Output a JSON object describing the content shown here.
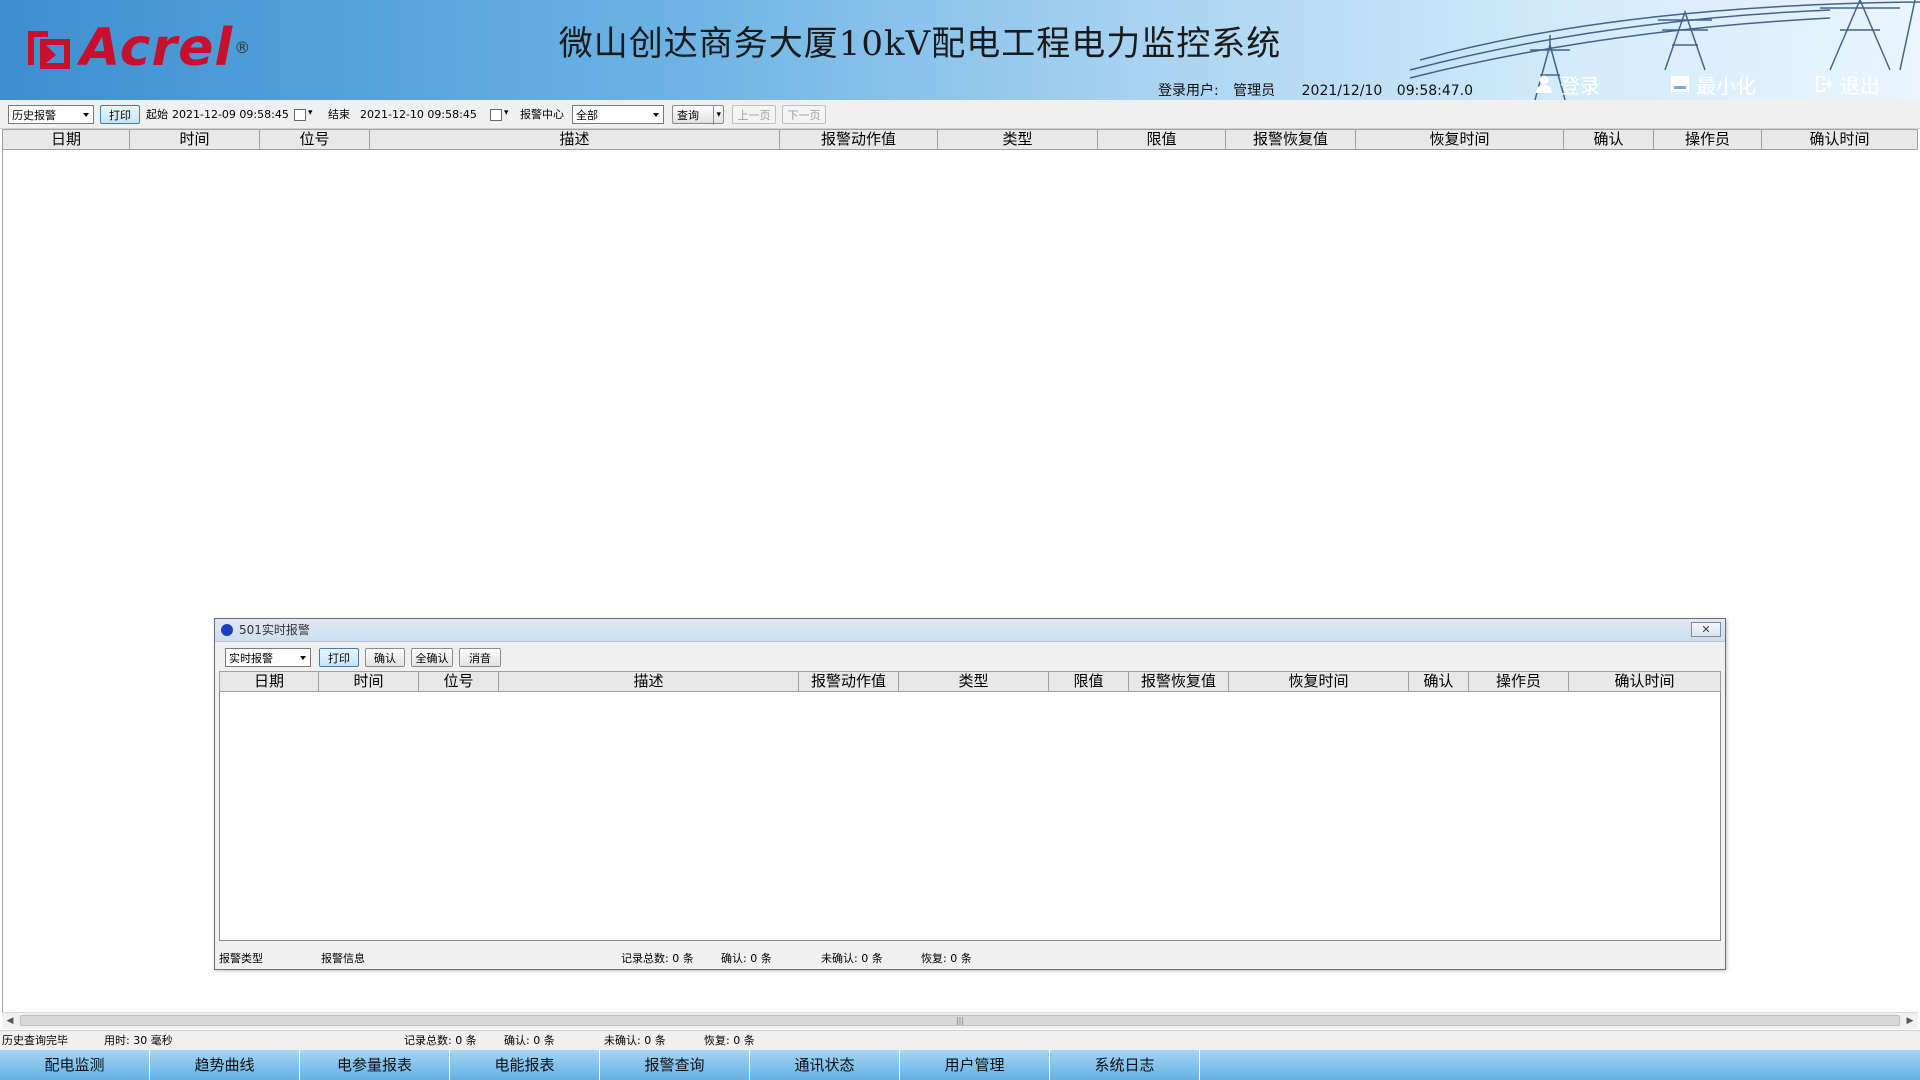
{
  "header": {
    "logo_text": "Acrel",
    "logo_reg": "®",
    "title": "微山创达商务大厦10kV配电工程电力监控系统",
    "login_label": "登录用户:",
    "user": "管理员",
    "date": "2021/12/10",
    "time": "09:58:47.0",
    "buttons": {
      "login": "登录",
      "minimize": "最小化",
      "exit": "退出"
    }
  },
  "toolbar": {
    "mode_select": "历史报警",
    "print": "打印",
    "start_label": "起始",
    "start_value": "2021-12-09 09:58:45",
    "end_label": "结束",
    "end_value": "2021-12-10 09:58:45",
    "center_label": "报警中心",
    "center_select": "全部",
    "query": "查询",
    "prev_page": "上一页",
    "next_page": "下一页"
  },
  "main_table": {
    "columns": [
      "日期",
      "时间",
      "位号",
      "描述",
      "报警动作值",
      "类型",
      "限值",
      "报警恢复值",
      "恢复时间",
      "确认",
      "操作员",
      "确认时间"
    ]
  },
  "popup": {
    "title": "501实时报警",
    "mode_select": "实时报警",
    "buttons": {
      "print": "打印",
      "confirm": "确认",
      "confirm_all": "全确认",
      "mute": "消音"
    },
    "columns": [
      "日期",
      "时间",
      "位号",
      "描述",
      "报警动作值",
      "类型",
      "限值",
      "报警恢复值",
      "恢复时间",
      "确认",
      "操作员",
      "确认时间"
    ],
    "status": {
      "alarm_type": "报警类型",
      "alarm_info": "报警信息",
      "total": "记录总数: 0 条",
      "confirmed": "确认: 0 条",
      "unconfirmed": "未确认: 0 条",
      "recovered": "恢复: 0 条"
    }
  },
  "statusbar": {
    "message": "历史查询完毕",
    "elapsed": "用时: 30 毫秒",
    "total": "记录总数: 0 条",
    "confirmed": "确认: 0 条",
    "unconfirmed": "未确认: 0 条",
    "recovered": "恢复: 0 条"
  },
  "nav": [
    "配电监测",
    "趋势曲线",
    "电参量报表",
    "电能报表",
    "报警查询",
    "通讯状态",
    "用户管理",
    "系统日志"
  ],
  "colors": {
    "brand_red": "#c8102e",
    "header_blue": "#3d8fd0",
    "nav_blue": "#63b0e4"
  }
}
